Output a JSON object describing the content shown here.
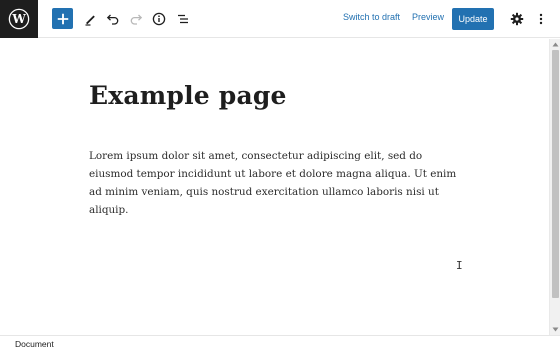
{
  "toolbar": {
    "logo_icon": "wordpress-logo",
    "inserter_icon": "plus-icon",
    "tools_icon": "pencil-icon",
    "undo_icon": "undo-icon",
    "redo_icon": "redo-icon",
    "details_icon": "info-icon",
    "list_view_icon": "list-view-icon",
    "switch_to_draft_label": "Switch to draft",
    "preview_label": "Preview",
    "update_label": "Update",
    "settings_icon": "gear-icon",
    "options_icon": "vertical-ellipsis-icon",
    "accent_color": "#2271b1"
  },
  "editor": {
    "title": "Example page",
    "paragraph": "Lorem ipsum dolor sit amet, consectetur adipiscing elit, sed do eiusmod tempor incididunt ut labore et dolore magna aliqua. Ut enim ad minim veniam, quis nostrud exercitation ullamco laboris nisi ut aliquip."
  },
  "footer": {
    "breadcrumb": "Document"
  }
}
